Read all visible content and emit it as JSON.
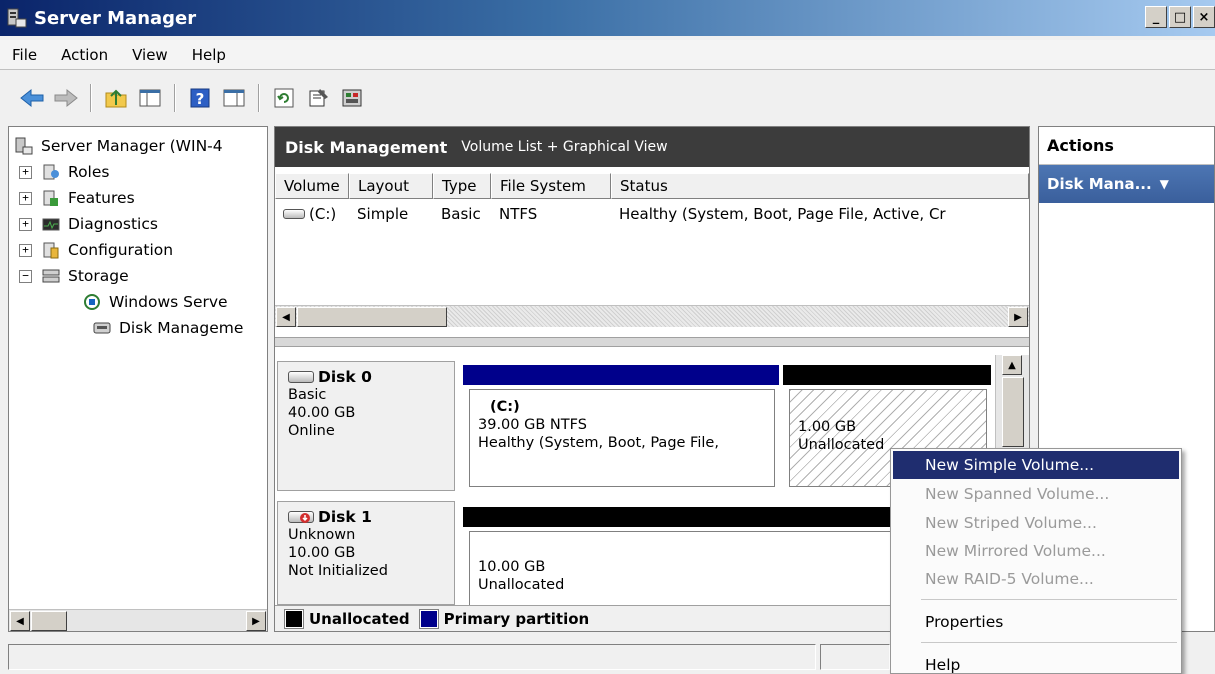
{
  "window": {
    "title": "Server Manager",
    "controls": {
      "minimize": "_",
      "maximize": "□",
      "close": "×"
    }
  },
  "menu": [
    "File",
    "Action",
    "View",
    "Help"
  ],
  "toolbar": {
    "icons": [
      "back-arrow-icon",
      "forward-arrow-icon",
      "up-folder-icon",
      "show-hide-tree-icon",
      "help-icon",
      "show-hide-action-pane-icon",
      "refresh-icon",
      "properties-icon",
      "disk-settings-icon"
    ]
  },
  "tree": {
    "root": "Server Manager (WIN-4",
    "items": [
      {
        "label": "Roles",
        "expander": "+"
      },
      {
        "label": "Features",
        "expander": "+"
      },
      {
        "label": "Diagnostics",
        "expander": "+"
      },
      {
        "label": "Configuration",
        "expander": "+"
      },
      {
        "label": "Storage",
        "expander": "−"
      }
    ],
    "children": [
      {
        "label": "Windows Serve"
      },
      {
        "label": "Disk Manageme"
      }
    ]
  },
  "disk_management": {
    "title": "Disk Management",
    "subtitle": "Volume List + Graphical View",
    "columns": [
      "Volume",
      "Layout",
      "Type",
      "File System",
      "Status"
    ],
    "volumes": [
      {
        "volume": "(C:)",
        "layout": "Simple",
        "type": "Basic",
        "file_system": "NTFS",
        "status": "Healthy (System, Boot, Page File, Active, Cr"
      }
    ],
    "disks": [
      {
        "name": "Disk 0",
        "type": "Basic",
        "size": "40.00 GB",
        "state": "Online",
        "partitions": [
          {
            "label": "(C:)",
            "size_fs": "39.00 GB NTFS",
            "status": "Healthy (System, Boot, Page File,"
          },
          {
            "size": "1.00 GB",
            "status": "Unallocated"
          }
        ]
      },
      {
        "name": "Disk 1",
        "type": "Unknown",
        "size": "10.00 GB",
        "state": "Not Initialized",
        "partitions": [
          {
            "size": "10.00 GB",
            "status": "Unallocated"
          }
        ]
      }
    ],
    "legend": [
      {
        "label": "Unallocated",
        "color": "#000000"
      },
      {
        "label": "Primary partition",
        "color": "#00008b"
      }
    ]
  },
  "actions": {
    "header": "Actions",
    "section": "Disk Mana...",
    "section_arrow": "▼"
  },
  "context_menu": {
    "items": [
      {
        "label": "New Simple Volume...",
        "state": "selected"
      },
      {
        "label": "New Spanned Volume...",
        "state": "disabled"
      },
      {
        "label": "New Striped Volume...",
        "state": "disabled"
      },
      {
        "label": "New Mirrored Volume...",
        "state": "disabled"
      },
      {
        "label": "New RAID-5 Volume...",
        "state": "disabled"
      },
      {
        "label": "Properties",
        "state": "enabled"
      },
      {
        "label": "Help",
        "state": "enabled"
      }
    ]
  },
  "colors": {
    "primary_partition": "#00008b",
    "unallocated": "#000000",
    "menu_highlight": "#1f2d6f",
    "header_bg": "#3c3c3c"
  }
}
